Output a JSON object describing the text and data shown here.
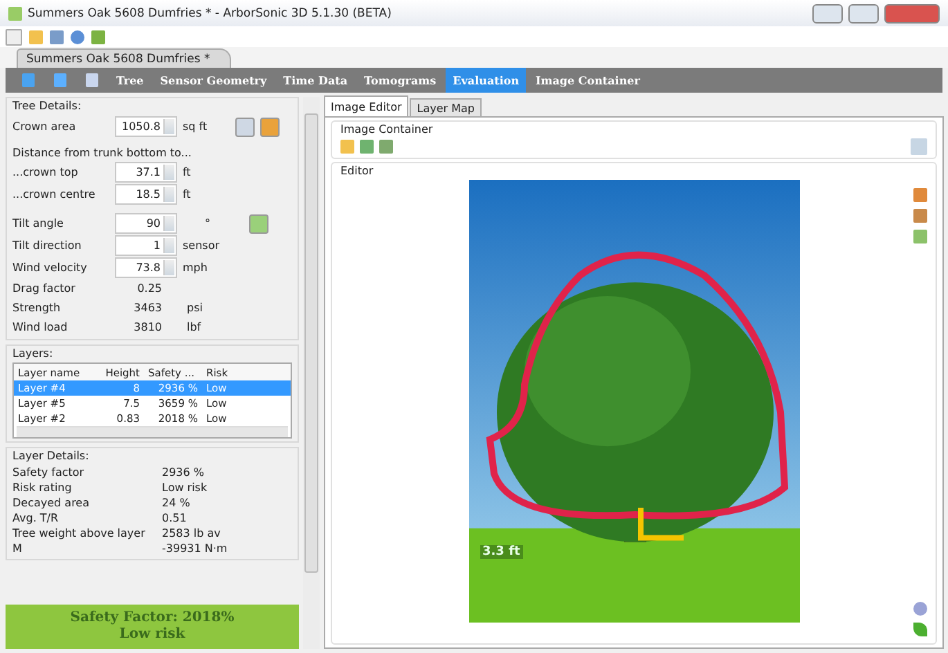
{
  "window": {
    "title": "Summers Oak 5608 Dumfries * - ArborSonic 3D 5.1.30 (BETA)"
  },
  "document_tab": {
    "label": "Summers Oak 5608 Dumfries *"
  },
  "nav": [
    {
      "label": "Tree",
      "selected": false
    },
    {
      "label": "Sensor Geometry",
      "selected": false
    },
    {
      "label": "Time Data",
      "selected": false
    },
    {
      "label": "Tomograms",
      "selected": false
    },
    {
      "label": "Evaluation",
      "selected": true
    },
    {
      "label": "Image Container",
      "selected": false
    }
  ],
  "tree_details": {
    "title": "Tree Details:",
    "rows": [
      {
        "kind": "spin",
        "label": "Crown area",
        "value": "1050.8",
        "unit": "sq ft"
      },
      {
        "kind": "heading",
        "label": "Distance from trunk bottom to..."
      },
      {
        "kind": "spin",
        "label": "...crown top",
        "value": "37.1",
        "unit": "ft"
      },
      {
        "kind": "spin",
        "label": "...crown centre",
        "value": "18.5",
        "unit": "ft"
      },
      {
        "kind": "spin",
        "label": "Tilt angle",
        "value": "90",
        "unit": "°"
      },
      {
        "kind": "spin",
        "label": "Tilt direction",
        "value": "1",
        "unit": "sensor"
      },
      {
        "kind": "spin",
        "label": "Wind velocity",
        "value": "73.8",
        "unit": "mph"
      },
      {
        "kind": "readout",
        "label": "Drag factor",
        "value": "0.25"
      },
      {
        "kind": "readout",
        "label": "Strength",
        "value": "3463",
        "unit": "psi"
      },
      {
        "kind": "readout",
        "label": "Wind load",
        "value": "3810",
        "unit": "lbf"
      }
    ]
  },
  "layers": {
    "title": "Layers:",
    "columns": [
      "Layer name",
      "Height",
      "Safety ...",
      "Risk"
    ],
    "rows": [
      {
        "cells": [
          "Layer #4",
          "8",
          "2936 %",
          "Low"
        ],
        "selected": true
      },
      {
        "cells": [
          "Layer #5",
          "7.5",
          "3659 %",
          "Low"
        ],
        "selected": false
      },
      {
        "cells": [
          "Layer #2",
          "0.83",
          "2018 %",
          "Low"
        ],
        "selected": false
      }
    ]
  },
  "layer_details": {
    "title": "Layer Details:",
    "rows": [
      {
        "label": "Safety factor",
        "value": "2936 %"
      },
      {
        "label": "Risk rating",
        "value": "Low risk"
      },
      {
        "label": "Decayed area",
        "value": "24 %"
      },
      {
        "label": "Avg. T/R",
        "value": "0.51"
      },
      {
        "label": "Tree weight above layer",
        "value": "2583 lb av"
      },
      {
        "label": "M",
        "value": "-39931 N·m"
      }
    ]
  },
  "summary": {
    "safety": "Safety Factor: 2018%",
    "risk": "Low risk"
  },
  "editor_tabs": [
    {
      "label": "Image Editor",
      "selected": true
    },
    {
      "label": "Layer Map",
      "selected": false
    }
  ],
  "image_container": {
    "title": "Image Container"
  },
  "editor": {
    "title": "Editor",
    "measurement": "3.3 ft"
  }
}
